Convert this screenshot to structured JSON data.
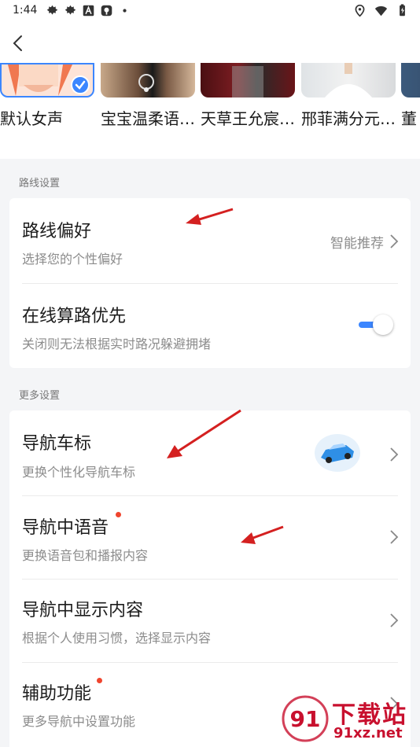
{
  "status_bar": {
    "time": "1:44",
    "icons_left": [
      "gear-icon",
      "gear-icon",
      "a-icon",
      "tag-icon",
      "dot"
    ],
    "icons_right": [
      "location-icon",
      "wifi-icon",
      "battery-icon"
    ]
  },
  "voices": [
    {
      "label": "默认女声",
      "selected": true
    },
    {
      "label": "宝宝温柔语…"
    },
    {
      "label": "天草王允宸…"
    },
    {
      "label": "邢菲满分元…"
    },
    {
      "label": "董"
    }
  ],
  "sections": {
    "route": {
      "title": "路线设置",
      "rows": [
        {
          "title": "路线偏好",
          "subtitle": "选择您的个性偏好",
          "value": "智能推荐"
        },
        {
          "title": "在线算路优先",
          "subtitle": "关闭则无法根据实时路况躲避拥堵",
          "toggle_on": true
        }
      ]
    },
    "more": {
      "title": "更多设置",
      "rows": [
        {
          "title": "导航车标",
          "subtitle": "更换个性化导航车标"
        },
        {
          "title": "导航中语音",
          "subtitle": "更换语音包和播报内容",
          "badge": true
        },
        {
          "title": "导航中显示内容",
          "subtitle": "根据个人使用习惯，选择显示内容"
        },
        {
          "title": "辅助功能",
          "subtitle": "更多导航中设置功能",
          "badge": true
        }
      ]
    }
  },
  "watermark": {
    "logo": "91",
    "title": "下载站",
    "url": "91xz.net"
  },
  "colors": {
    "accent": "#3b86ff",
    "badge": "#f0452e",
    "annotation": "#d42020"
  }
}
